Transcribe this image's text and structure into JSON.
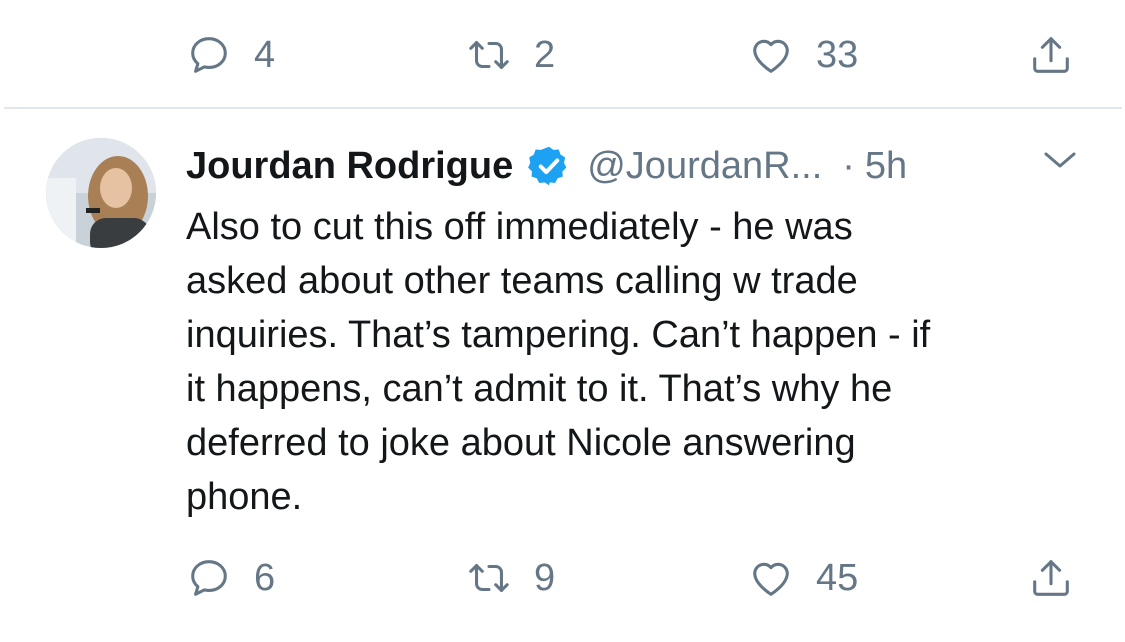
{
  "top_actions": {
    "replies": "4",
    "retweets": "2",
    "likes": "33"
  },
  "tweet": {
    "display_name": "Jourdan Rodrigue",
    "verified_icon": "verified-badge-icon",
    "handle": "@JourdanR...",
    "separator": "·",
    "time": "5h",
    "text": "Also to cut this off immediately - he was\nasked about other teams calling w trade\ninquiries. That’s tampering. Can’t happen - if\nit happens, can’t admit to it. That’s why he\ndeferred to joke about Nicole answering\nphone.",
    "replies": "6",
    "retweets": "9",
    "likes": "45"
  },
  "colors": {
    "icon_gray": "#657786",
    "text": "#14171a",
    "verified_blue": "#1da1f2",
    "divider": "#e1e8ed"
  },
  "icons": {
    "reply": "reply-icon",
    "retweet": "retweet-icon",
    "like": "heart-icon",
    "share": "share-icon",
    "menu": "chevron-down-icon"
  }
}
